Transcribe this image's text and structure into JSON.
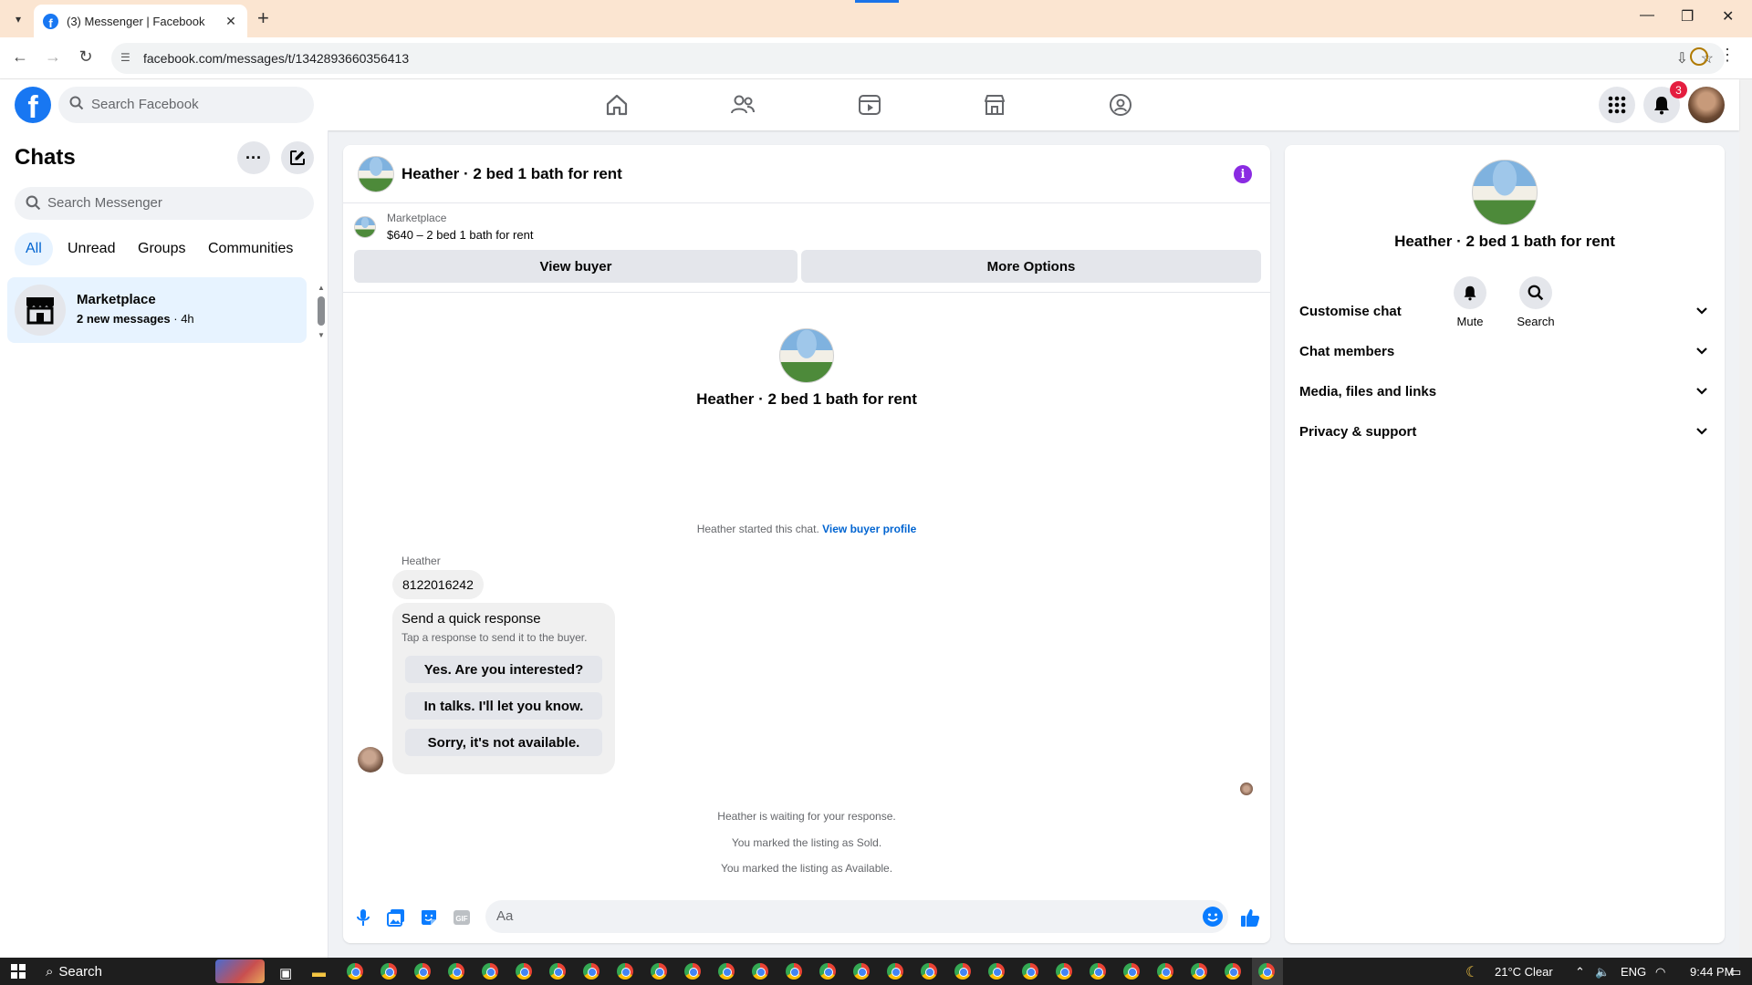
{
  "browser": {
    "tab_title": "(3) Messenger | Facebook",
    "url": "facebook.com/messages/t/1342893660356413"
  },
  "fb_header": {
    "search_placeholder": "Search Facebook",
    "notification_count": "3"
  },
  "chats": {
    "title": "Chats",
    "search_placeholder": "Search Messenger",
    "filters": [
      "All",
      "Unread",
      "Groups",
      "Communities"
    ],
    "active_filter": "All",
    "items": [
      {
        "name": "Marketplace",
        "new_messages": "2 new messages",
        "time": "· 4h"
      }
    ]
  },
  "conversation": {
    "header_name": "Heather · 2 bed 1 bath for rent",
    "marketplace_label": "Marketplace",
    "listing": "$640 – 2 bed 1 bath for rent",
    "view_buyer": "View buyer",
    "more_options": "More Options",
    "intro_name": "Heather · 2 bed 1 bath for rent",
    "started_text": "Heather started this chat.",
    "view_buyer_profile": "View buyer profile",
    "sender": "Heather",
    "message": "8122016242",
    "quick_title": "Send a quick response",
    "quick_sub": "Tap a response to send it to the buyer.",
    "quick_responses": [
      "Yes. Are you interested?",
      "In talks. I'll let you know.",
      "Sorry, it's not available."
    ],
    "system_messages": [
      "Heather is waiting for your response.",
      "You marked the listing as Sold.",
      "You marked the listing as Available."
    ],
    "composer_placeholder": "Aa"
  },
  "info_panel": {
    "name": "Heather · 2 bed 1 bath for rent",
    "actions": [
      "Mute",
      "Search"
    ],
    "sections": [
      "Customise chat",
      "Chat members",
      "Media, files and links",
      "Privacy & support"
    ]
  },
  "taskbar": {
    "search": "Search",
    "weather": "21°C  Clear",
    "lang": "ENG",
    "time": "9:44 PM"
  },
  "colors": {
    "brand": "#1877f2",
    "accent_link": "#0064d1",
    "selected_bg": "#e7f3ff",
    "info_purple": "#8a2be2"
  }
}
